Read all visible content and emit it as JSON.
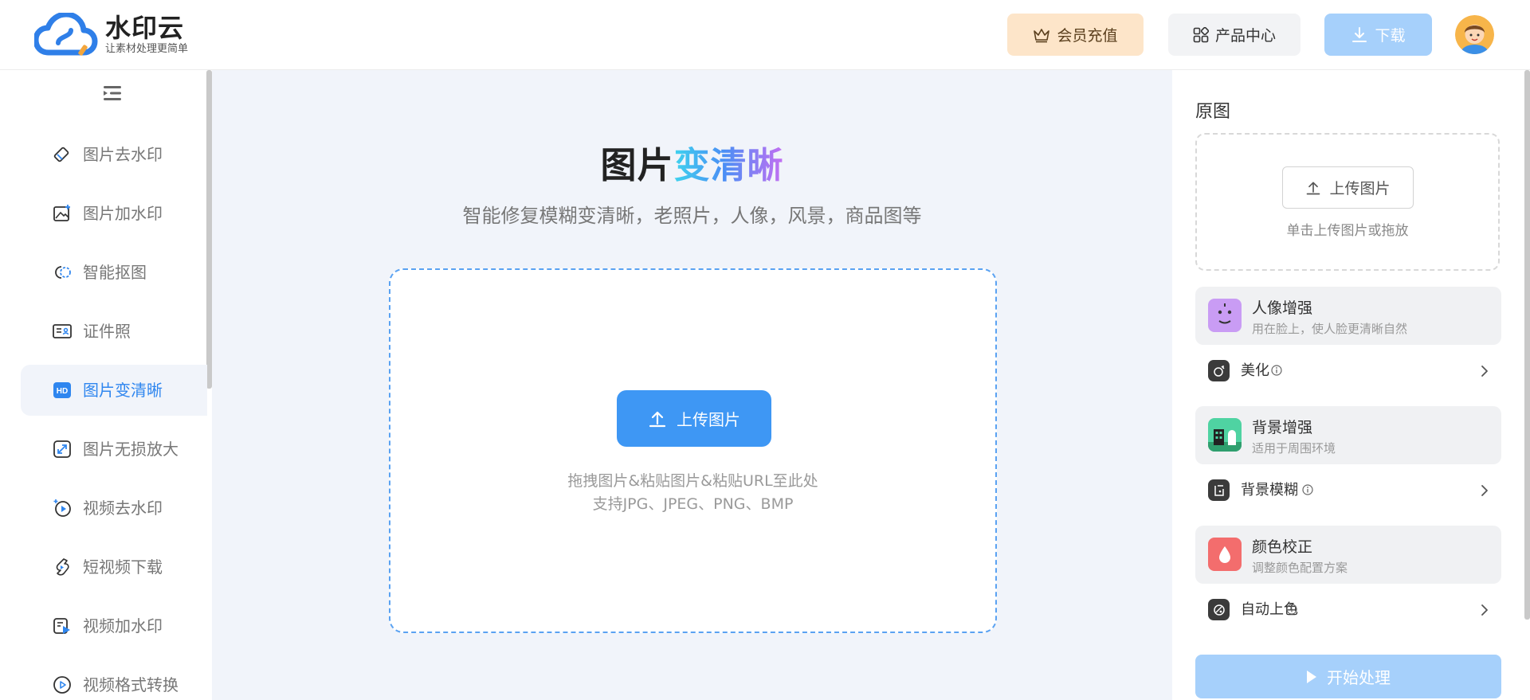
{
  "header": {
    "logo_title": "水印云",
    "logo_slogan": "让素材处理更简单",
    "vip_label": "会员充值",
    "products_label": "产品中心",
    "download_label": "下载"
  },
  "sidebar": {
    "items": [
      {
        "label": "图片去水印",
        "icon": "eraser-icon"
      },
      {
        "label": "图片加水印",
        "icon": "image-add-icon"
      },
      {
        "label": "智能抠图",
        "icon": "cutout-icon"
      },
      {
        "label": "证件照",
        "icon": "id-card-icon"
      },
      {
        "label": "图片变清晰",
        "icon": "hd-icon",
        "active": true
      },
      {
        "label": "图片无损放大",
        "icon": "enlarge-icon"
      },
      {
        "label": "视频去水印",
        "icon": "video-eraser-icon"
      },
      {
        "label": "短视频下载",
        "icon": "short-video-download-icon"
      },
      {
        "label": "视频加水印",
        "icon": "video-watermark-icon"
      },
      {
        "label": "视频格式转换",
        "icon": "video-convert-icon"
      }
    ]
  },
  "main": {
    "title_plain": "图片",
    "title_highlight": "变清晰",
    "subtitle": "智能修复模糊变清晰，老照片，人像，风景，商品图等",
    "upload_label": "上传图片",
    "hint_line1": "拖拽图片&粘贴图片&粘贴URL至此处",
    "hint_line2": "支持JPG、JPEG、PNG、BMP"
  },
  "panel": {
    "title": "原图",
    "upload_label": "上传图片",
    "upload_hint": "单击上传图片或拖放",
    "sections": [
      {
        "title": "人像增强",
        "subtitle": "用在脸上，使人脸更清晰自然",
        "icon": "face-icon",
        "option": "美化",
        "option_icon": "beautify-icon"
      },
      {
        "title": "背景增强",
        "subtitle": "适用于周围环境",
        "icon": "building-icon",
        "option": "背景模糊",
        "option_icon": "background-blur-icon"
      },
      {
        "title": "颜色校正",
        "subtitle": "调整颜色配置方案",
        "icon": "color-drop-icon",
        "option": "自动上色",
        "option_icon": "auto-color-icon"
      }
    ],
    "start_label": "开始处理"
  },
  "colors": {
    "primary": "#3e97f4",
    "active_text": "#2f86ef",
    "main_bg": "#f1f4fa",
    "vip_bg": "#fde5c9",
    "disabled_button": "#a6d0fb"
  }
}
